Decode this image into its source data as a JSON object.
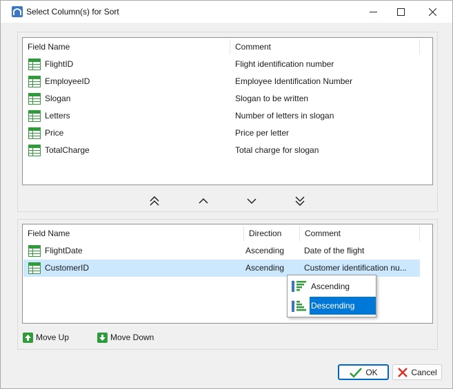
{
  "window": {
    "title": "Select Column(s) for Sort"
  },
  "available": {
    "headers": {
      "field_name": "Field Name",
      "comment": "Comment"
    },
    "rows": [
      {
        "field": "FlightID",
        "comment": "Flight identification number"
      },
      {
        "field": "EmployeeID",
        "comment": "Employee Identification Number"
      },
      {
        "field": "Slogan",
        "comment": "Slogan to be written"
      },
      {
        "field": "Letters",
        "comment": "Number of letters in slogan"
      },
      {
        "field": "Price",
        "comment": "Price per letter"
      },
      {
        "field": "TotalCharge",
        "comment": "Total charge for slogan"
      }
    ]
  },
  "arrows": [
    "double-chevron-up-icon",
    "chevron-up-icon",
    "chevron-down-icon",
    "double-chevron-down-icon"
  ],
  "selected": {
    "headers": {
      "field_name": "Field Name",
      "direction": "Direction",
      "comment": "Comment"
    },
    "rows": [
      {
        "field": "FlightDate",
        "direction": "Ascending",
        "comment": "Date of the flight"
      },
      {
        "field": "CustomerID",
        "direction": "Ascending",
        "comment": "Customer identification nu..."
      }
    ]
  },
  "direction_menu": {
    "options": [
      "Ascending",
      "Descending"
    ],
    "highlighted": "Descending"
  },
  "actions": {
    "move_up": "Move Up",
    "move_down": "Move Down"
  },
  "buttons": {
    "ok": "OK",
    "cancel": "Cancel"
  },
  "colors": {
    "selection": "#cce8ff",
    "menu_highlight": "#0078d7",
    "field_icon": "#2f9b3a",
    "ok_border": "#0067c0",
    "cancel_x": "#d93025"
  }
}
